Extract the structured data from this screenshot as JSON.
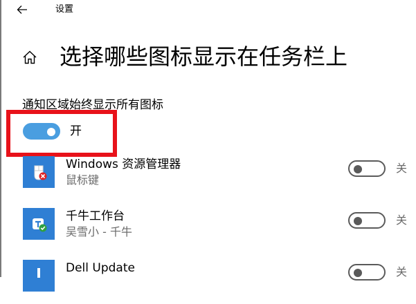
{
  "window": {
    "title": "设置"
  },
  "page": {
    "title": "选择哪些图标显示在任务栏上"
  },
  "always_show": {
    "label": "通知区域始终显示所有图标",
    "state_label": "开",
    "on": true
  },
  "apps": [
    {
      "name": "Windows 资源管理器",
      "subtitle": "鼠标键",
      "state_label": "关",
      "on": false,
      "icon": "explorer-mouse-keys-icon"
    },
    {
      "name": "千牛工作台",
      "subtitle": "吴雪小 - 千牛",
      "state_label": "关",
      "on": false,
      "icon": "qianniu-icon"
    },
    {
      "name": "Dell Update",
      "subtitle": "",
      "state_label": "关",
      "on": false,
      "icon": "dell-update-icon"
    }
  ],
  "colors": {
    "accent": "#4a9ee0",
    "highlight": "#e8121a",
    "app_tile": "#2f7fd4",
    "secondary_text": "#6b6b6b"
  }
}
